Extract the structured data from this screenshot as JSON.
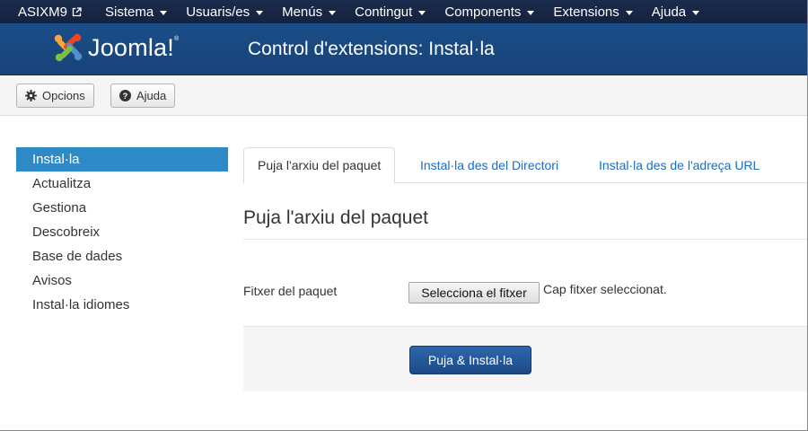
{
  "navbar": {
    "site_name": "ASIXM9",
    "external_link_icon": "external-link-icon",
    "menus": [
      "Sistema",
      "Usuaris/es",
      "Menús",
      "Contingut",
      "Components",
      "Extensions",
      "Ajuda"
    ]
  },
  "header": {
    "logo_text": "Joomla!",
    "logo_mark": "®",
    "title": "Control d'extensions: Instal·la"
  },
  "toolbar": {
    "options_label": "Opcions",
    "options_icon": "gear-icon",
    "help_label": "Ajuda",
    "help_icon": "question-circle-icon"
  },
  "sidebar": {
    "items": [
      "Instal·la",
      "Actualitza",
      "Gestiona",
      "Descobreix",
      "Base de dades",
      "Avisos",
      "Instal·la idiomes"
    ],
    "active_index": 0
  },
  "tabs": [
    {
      "label": "Puja l'arxiu del paquet",
      "active": true
    },
    {
      "label": "Instal·la des del Directori",
      "active": false
    },
    {
      "label": "Instal·la des de l'adreça URL",
      "active": false
    }
  ],
  "main": {
    "section_title": "Puja l'arxiu del paquet",
    "field_label": "Fitxer del paquet",
    "file_button": "Selecciona el fitxer",
    "file_status": "Cap fitxer seleccionat.",
    "submit_label": "Puja & Instal·la"
  },
  "colors": {
    "navbar": "#1b2c4d",
    "header": "#1a4d87",
    "active_item": "#2d8ac7",
    "link": "#1a6cc5",
    "primary_button": "#2e66ac"
  }
}
